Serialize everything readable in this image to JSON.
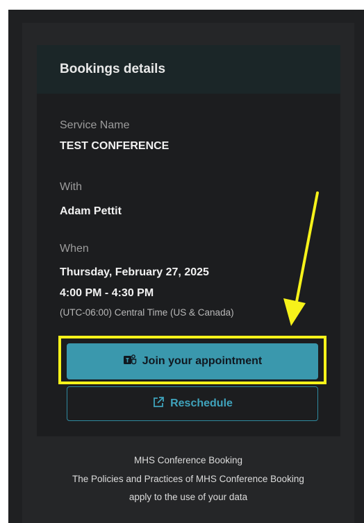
{
  "card": {
    "title": "Bookings details",
    "service_label": "Service Name",
    "service_value": "TEST CONFERENCE",
    "with_label": "With",
    "with_value": "Adam Pettit",
    "when_label": "When",
    "date": "Thursday, February 27, 2025",
    "time": "4:00 PM - 4:30 PM",
    "timezone": "(UTC-06:00) Central Time (US & Canada)"
  },
  "buttons": {
    "join_label": "Join your appointment",
    "reschedule_label": "Reschedule"
  },
  "footer": {
    "org": "MHS Conference Booking",
    "policy_line1": "The Policies and Practices of MHS Conference Booking",
    "policy_line2": "apply to the use of your data"
  },
  "colors": {
    "accent": "#3a98ad",
    "annotation": "#f6f21a"
  },
  "icons": {
    "join": "teams-icon",
    "reschedule": "external-link-icon"
  }
}
